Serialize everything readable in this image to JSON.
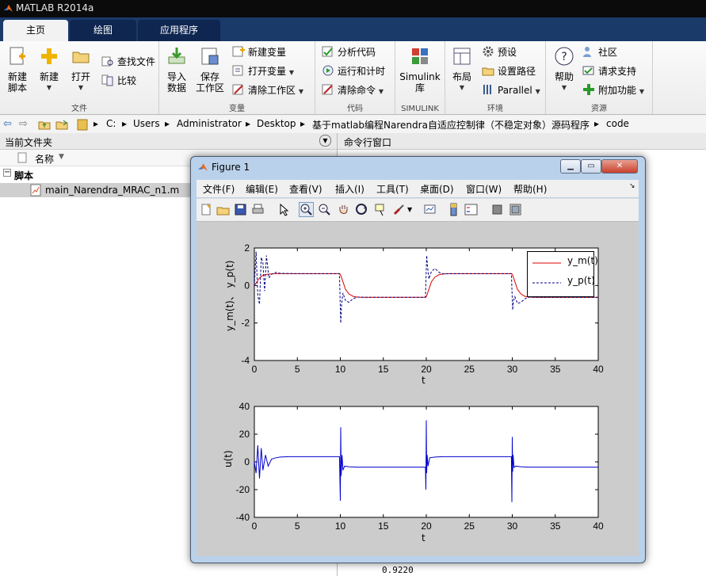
{
  "app": {
    "title": "MATLAB R2014a"
  },
  "tabs": [
    {
      "label": "主页"
    },
    {
      "label": "绘图"
    },
    {
      "label": "应用程序"
    }
  ],
  "ribbon": {
    "file_group": {
      "name": "文件",
      "new_script": "新建\n脚本",
      "new": "新建",
      "open": "打开",
      "find_files": "查找文件",
      "compare": "比较"
    },
    "variable_group": {
      "name": "变量",
      "import_data": "导入\n数据",
      "save_workspace": "保存\n工作区",
      "new_variable": "新建变量",
      "open_variable": "打开变量",
      "clear_workspace": "清除工作区"
    },
    "code_group": {
      "name": "代码",
      "analyze_code": "分析代码",
      "run_and_time": "运行和计时",
      "clear_commands": "清除命令"
    },
    "simulink_group": {
      "name": "SIMULINK",
      "simulink_library": "Simulink\n库"
    },
    "environment_group": {
      "name": "环境",
      "layout": "布局",
      "preferences": "预设",
      "set_path": "设置路径",
      "parallel": "Parallel"
    },
    "resources_group": {
      "name": "资源",
      "help": "帮助",
      "community": "社区",
      "request_support": "请求支持",
      "addons": "附加功能"
    }
  },
  "address": {
    "crumbs": [
      "C:",
      "Users",
      "Administrator",
      "Desktop",
      "基于matlab编程Narendra自适应控制律（不稳定对象）源码程序",
      "code"
    ]
  },
  "current_folder": {
    "title": "当前文件夹",
    "col_name": "名称",
    "section": "脚本",
    "files": [
      "main_Narendra_MRAC_n1.m"
    ]
  },
  "command_window": {
    "title": "命令行窗口",
    "visible_output": "0.9220"
  },
  "figure": {
    "title": "Figure 1",
    "menus": [
      "文件(F)",
      "编辑(E)",
      "查看(V)",
      "插入(I)",
      "工具(T)",
      "桌面(D)",
      "窗口(W)",
      "帮助(H)"
    ],
    "plot_top": {
      "xlabel": "t",
      "ylabel": "y_m(t)、 y_p(t)",
      "xlim": [
        0,
        40
      ],
      "ylim": [
        -4,
        2
      ],
      "xticks": [
        "0",
        "5",
        "10",
        "15",
        "20",
        "25",
        "30",
        "35",
        "40"
      ],
      "yticks": [
        "2",
        "0",
        "-2",
        "-4"
      ],
      "legend": [
        {
          "name": "y_m(t)",
          "color": "#dd0000",
          "style": "solid"
        },
        {
          "name": "y_p(t)",
          "color": "#000080",
          "style": "dashed"
        }
      ]
    },
    "plot_bottom": {
      "xlabel": "t",
      "ylabel": "u(t)",
      "xlim": [
        0,
        40
      ],
      "ylim": [
        -40,
        40
      ],
      "xticks": [
        "0",
        "5",
        "10",
        "15",
        "20",
        "25",
        "30",
        "35",
        "40"
      ],
      "yticks": [
        "40",
        "20",
        "0",
        "-20",
        "-40"
      ],
      "series_color": "#0000cc"
    }
  },
  "chart_data": [
    {
      "type": "line",
      "xlabel": "t",
      "ylabel": "y_m(t)、 y_p(t)",
      "xlim": [
        0,
        40
      ],
      "ylim": [
        -4,
        2
      ],
      "legend_position": "top-right",
      "series": [
        {
          "name": "y_m(t)",
          "x": [
            0,
            0.3,
            0.6,
            1,
            1.5,
            2,
            2.5,
            3,
            5,
            9.9,
            10,
            10.3,
            10.6,
            11,
            11.5,
            12,
            12.5,
            13,
            15,
            19.9,
            20,
            20.3,
            20.6,
            21,
            21.5,
            22,
            22.5,
            23,
            25,
            29.9,
            30,
            30.3,
            30.6,
            31,
            31.5,
            32,
            32.5,
            33,
            35,
            40
          ],
          "y": [
            0,
            0.2,
            0.4,
            0.55,
            0.6,
            0.62,
            0.63,
            0.63,
            0.63,
            0.63,
            0.6,
            0.2,
            -0.2,
            -0.45,
            -0.58,
            -0.62,
            -0.63,
            -0.63,
            -0.63,
            -0.63,
            -0.6,
            -0.2,
            0.2,
            0.45,
            0.58,
            0.62,
            0.63,
            0.63,
            0.63,
            0.63,
            0.6,
            0.2,
            -0.2,
            -0.45,
            -0.58,
            -0.62,
            -0.63,
            -0.63,
            -0.63,
            -0.63
          ]
        },
        {
          "name": "y_p(t)",
          "x": [
            0,
            0.2,
            0.4,
            0.6,
            0.8,
            1,
            1.2,
            1.4,
            1.7,
            2,
            2.5,
            3,
            5,
            9.9,
            10.05,
            10.15,
            10.3,
            10.6,
            11,
            11.5,
            12,
            13,
            15,
            19.9,
            20.05,
            20.15,
            20.3,
            20.6,
            21,
            21.5,
            22,
            23,
            25,
            29.9,
            30.05,
            30.15,
            30.3,
            30.6,
            31,
            31.5,
            32,
            33,
            35,
            40
          ],
          "y": [
            0,
            1.8,
            -0.5,
            -1.0,
            1.5,
            1.2,
            -0.3,
            1.6,
            0.4,
            0.6,
            0.7,
            0.65,
            0.63,
            0.63,
            -2.0,
            -1.0,
            -0.4,
            -0.8,
            -0.9,
            -0.7,
            -0.62,
            -0.63,
            -0.63,
            -0.63,
            1.6,
            1.0,
            0.35,
            0.75,
            0.9,
            0.7,
            0.62,
            0.63,
            0.63,
            0.63,
            -1.3,
            -0.8,
            -0.6,
            -0.95,
            -0.9,
            -0.7,
            -0.62,
            -0.63,
            -0.63,
            -0.63
          ]
        }
      ]
    },
    {
      "type": "line",
      "xlabel": "t",
      "ylabel": "u(t)",
      "xlim": [
        0,
        40
      ],
      "ylim": [
        -40,
        40
      ],
      "series": [
        {
          "name": "",
          "x": [
            0,
            0.2,
            0.4,
            0.6,
            0.8,
            1,
            1.3,
            1.6,
            2,
            2.5,
            3,
            4,
            6,
            9.9,
            10,
            10.05,
            10.1,
            10.2,
            10.3,
            10.5,
            11,
            12,
            13,
            15,
            19.9,
            19.95,
            20,
            20.05,
            20.1,
            20.2,
            20.4,
            21,
            22,
            23,
            25,
            29.9,
            29.95,
            30,
            30.05,
            30.1,
            30.2,
            30.4,
            31,
            32,
            33,
            35,
            40
          ],
          "y": [
            0,
            -8,
            12,
            -12,
            10,
            -6,
            5,
            -3,
            2,
            3,
            3.5,
            3.8,
            3.8,
            3.8,
            -28,
            25,
            -10,
            5,
            -6,
            -3,
            -3.5,
            -3.8,
            -3.8,
            -3.8,
            -3.8,
            -20,
            30,
            -8,
            5,
            -3,
            3,
            3.5,
            3.8,
            3.8,
            3.8,
            3.8,
            -29,
            18,
            -7,
            5,
            -4,
            -3,
            -3.5,
            -3.8,
            -3.8,
            -3.8,
            -3.8
          ]
        }
      ]
    }
  ]
}
